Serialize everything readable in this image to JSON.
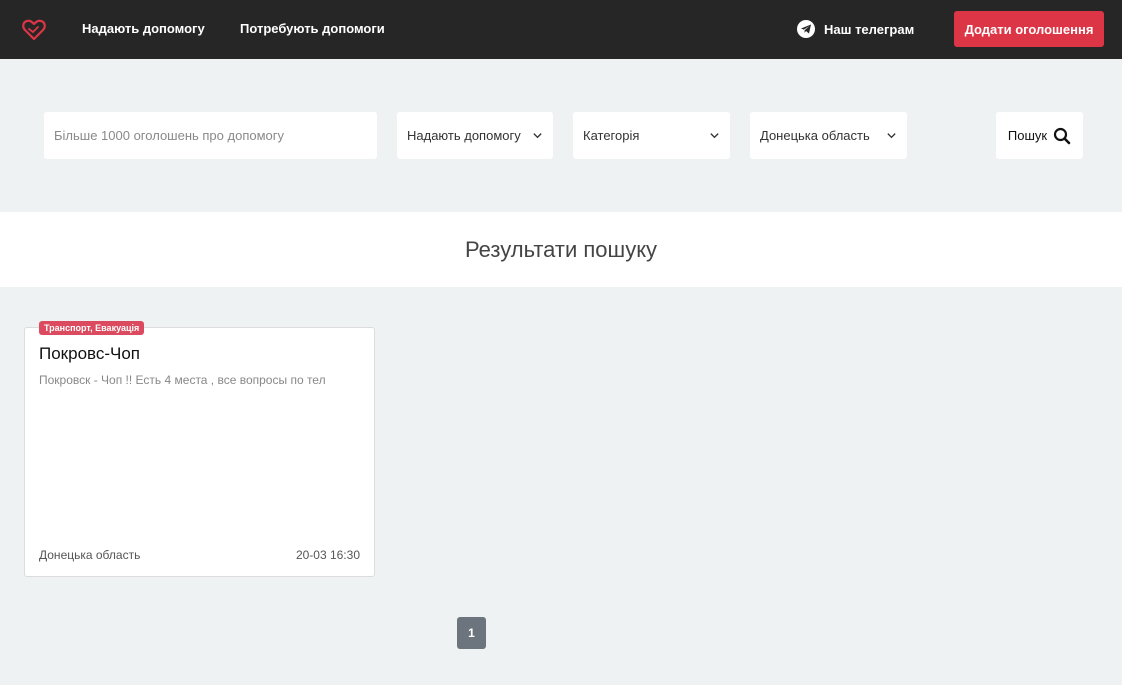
{
  "navbar": {
    "logo_icon": "heart-handshake-icon",
    "links": [
      {
        "label": "Надають допомогу"
      },
      {
        "label": "Потребують допомоги"
      }
    ],
    "telegram": {
      "label": "Наш телеграм",
      "icon": "telegram-icon"
    },
    "add_button": {
      "label": "Додати оголошення",
      "color": "#dc3545"
    }
  },
  "search": {
    "placeholder": "Більше 1000 оголошень про допомогу",
    "type_select": "Надають допомогу",
    "category_select": "Категорія",
    "region_select": "Донецька область",
    "button_label": "Пошук"
  },
  "results": {
    "title": "Результати пошуку",
    "cards": [
      {
        "badge": "Транспорт, Евакуація",
        "title": "Покровс-Чоп",
        "description": "Покровск - Чоп !! Есть 4 места , все вопросы по тел",
        "region": "Донецька область",
        "date": "20-03 16:30"
      }
    ]
  },
  "pagination": {
    "current_page": "1"
  },
  "colors": {
    "navbar": "#262626",
    "accent": "#dc3545",
    "badge": "#dc4a5f",
    "page_bg": "#eff2f3"
  }
}
